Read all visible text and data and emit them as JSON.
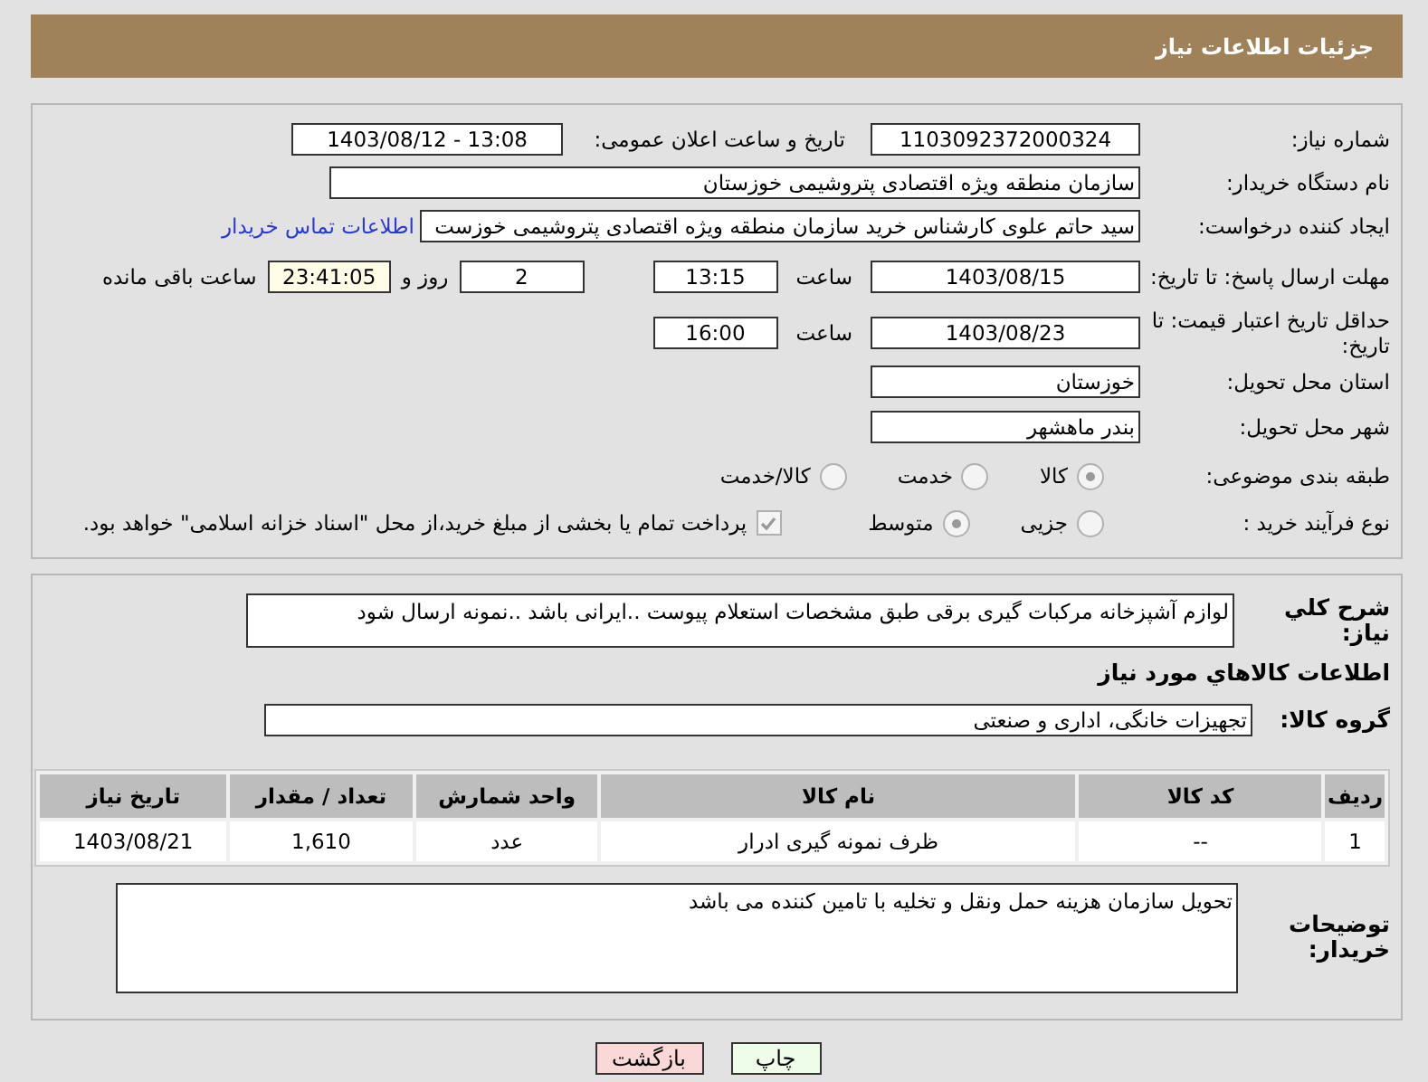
{
  "header": {
    "title": "جزئیات اطلاعات نیاز"
  },
  "need_number": {
    "label": "شماره نیاز:",
    "value": "1103092372000324"
  },
  "announce_datetime": {
    "label": "تاریخ و ساعت اعلان عمومی:",
    "value": "1403/08/12 - 13:08"
  },
  "buyer_org": {
    "label": "نام دستگاه خریدار:",
    "value": "سازمان منطقه ویژه اقتصادی پتروشیمی خوزستان"
  },
  "requester": {
    "label": "ایجاد کننده درخواست:",
    "value": "سید حاتم علوی کارشناس خرید سازمان منطقه ویژه اقتصادی پتروشیمی خوزست",
    "link": "اطلاعات تماس خریدار"
  },
  "reply_deadline": {
    "label": "مهلت ارسال پاسخ: تا تاریخ:",
    "date": "1403/08/15",
    "time_label": "ساعت",
    "time": "13:15",
    "days": "2",
    "days_label": "روز و",
    "remaining": "23:41:05",
    "remaining_label": "ساعت باقی مانده"
  },
  "price_validity": {
    "label": "حداقل تاریخ اعتبار قیمت: تا تاریخ:",
    "date": "1403/08/23",
    "time_label": "ساعت",
    "time": "16:00"
  },
  "province": {
    "label": "استان محل تحویل:",
    "value": "خوزستان"
  },
  "city": {
    "label": "شهر محل تحویل:",
    "value": "بندر ماهشهر"
  },
  "category": {
    "label": "طبقه بندی موضوعی:",
    "options": [
      {
        "label": "کالا",
        "selected": true
      },
      {
        "label": "خدمت",
        "selected": false
      },
      {
        "label": "کالا/خدمت",
        "selected": false
      }
    ]
  },
  "process": {
    "label": "نوع فرآیند خرید :",
    "options": [
      {
        "label": "جزیی",
        "selected": false
      },
      {
        "label": "متوسط",
        "selected": true
      }
    ],
    "treasury": {
      "checked": true,
      "text": "پرداخت تمام یا بخشی از مبلغ خرید،از محل \"اسناد خزانه اسلامی\" خواهد بود."
    }
  },
  "description": {
    "label": "شرح كلي نياز:",
    "value": "لوازم آشپزخانه مرکبات گیری برقی طبق مشخصات استعلام پیوست ..ایرانی باشد ..نمونه ارسال شود"
  },
  "goods_heading": "اطلاعات كالاهاي مورد نياز",
  "goods_group": {
    "label": "گروه کالا:",
    "value": "تجهیزات خانگی، اداری و صنعتی"
  },
  "table": {
    "columns": [
      "ردیف",
      "کد کالا",
      "نام کالا",
      "واحد شمارش",
      "تعداد / مقدار",
      "تاریخ نیاز"
    ],
    "rows": [
      [
        "1",
        "--",
        "ظرف نمونه گیری ادرار",
        "عدد",
        "1,610",
        "1403/08/21"
      ]
    ]
  },
  "buyer_notes": {
    "label": "توضیحات خریدار:",
    "value": "تحویل سازمان هزینه حمل ونقل و تخلیه با تامین کننده می باشد"
  },
  "buttons": [
    {
      "label": "چاپ",
      "kind": "print"
    },
    {
      "label": "بازگشت",
      "kind": "back"
    }
  ]
}
